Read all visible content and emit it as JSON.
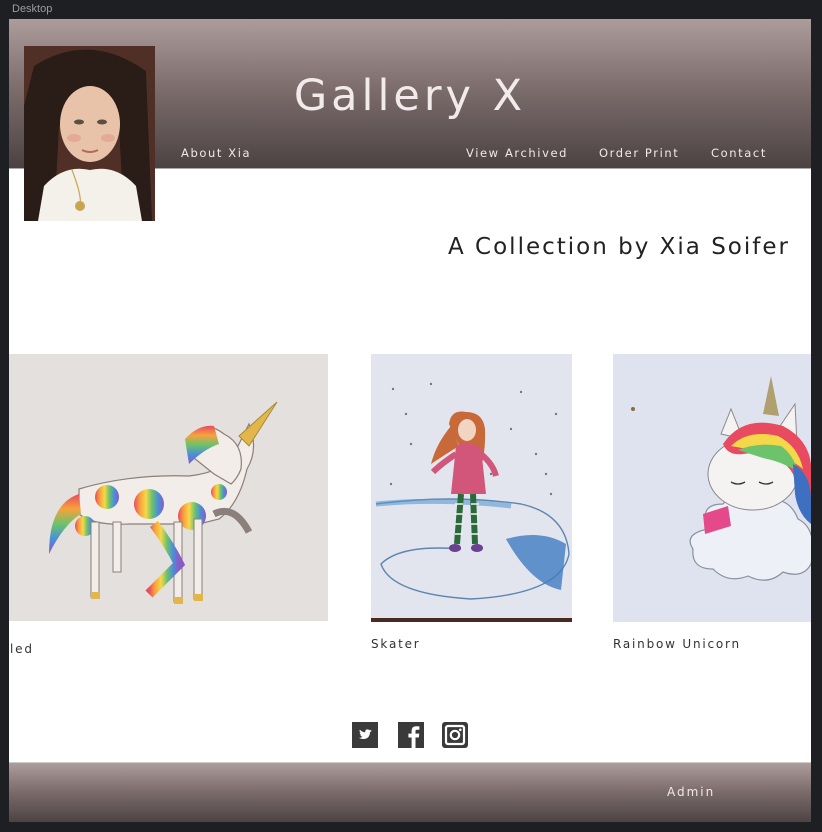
{
  "window": {
    "frame_label": "Desktop"
  },
  "header": {
    "site_title": "Gallery X",
    "nav": {
      "about": "About Xia",
      "archived": "View Archived",
      "order": "Order Print",
      "contact": "Contact"
    }
  },
  "main": {
    "collection_title": "A Collection by Xia Soifer",
    "artworks": [
      {
        "caption": "led"
      },
      {
        "caption": "Skater"
      },
      {
        "caption": "Rainbow Unicorn"
      }
    ]
  },
  "social": {
    "icons": [
      "twitter-icon",
      "facebook-icon",
      "instagram-icon"
    ]
  },
  "footer": {
    "admin_label": "Admin"
  },
  "colors": {
    "header_gradient_top": "#ad9c9c",
    "header_gradient_bottom": "#4c4242",
    "title_text": "#f3ebeb",
    "social_icon_bg": "#3a3a3a"
  }
}
